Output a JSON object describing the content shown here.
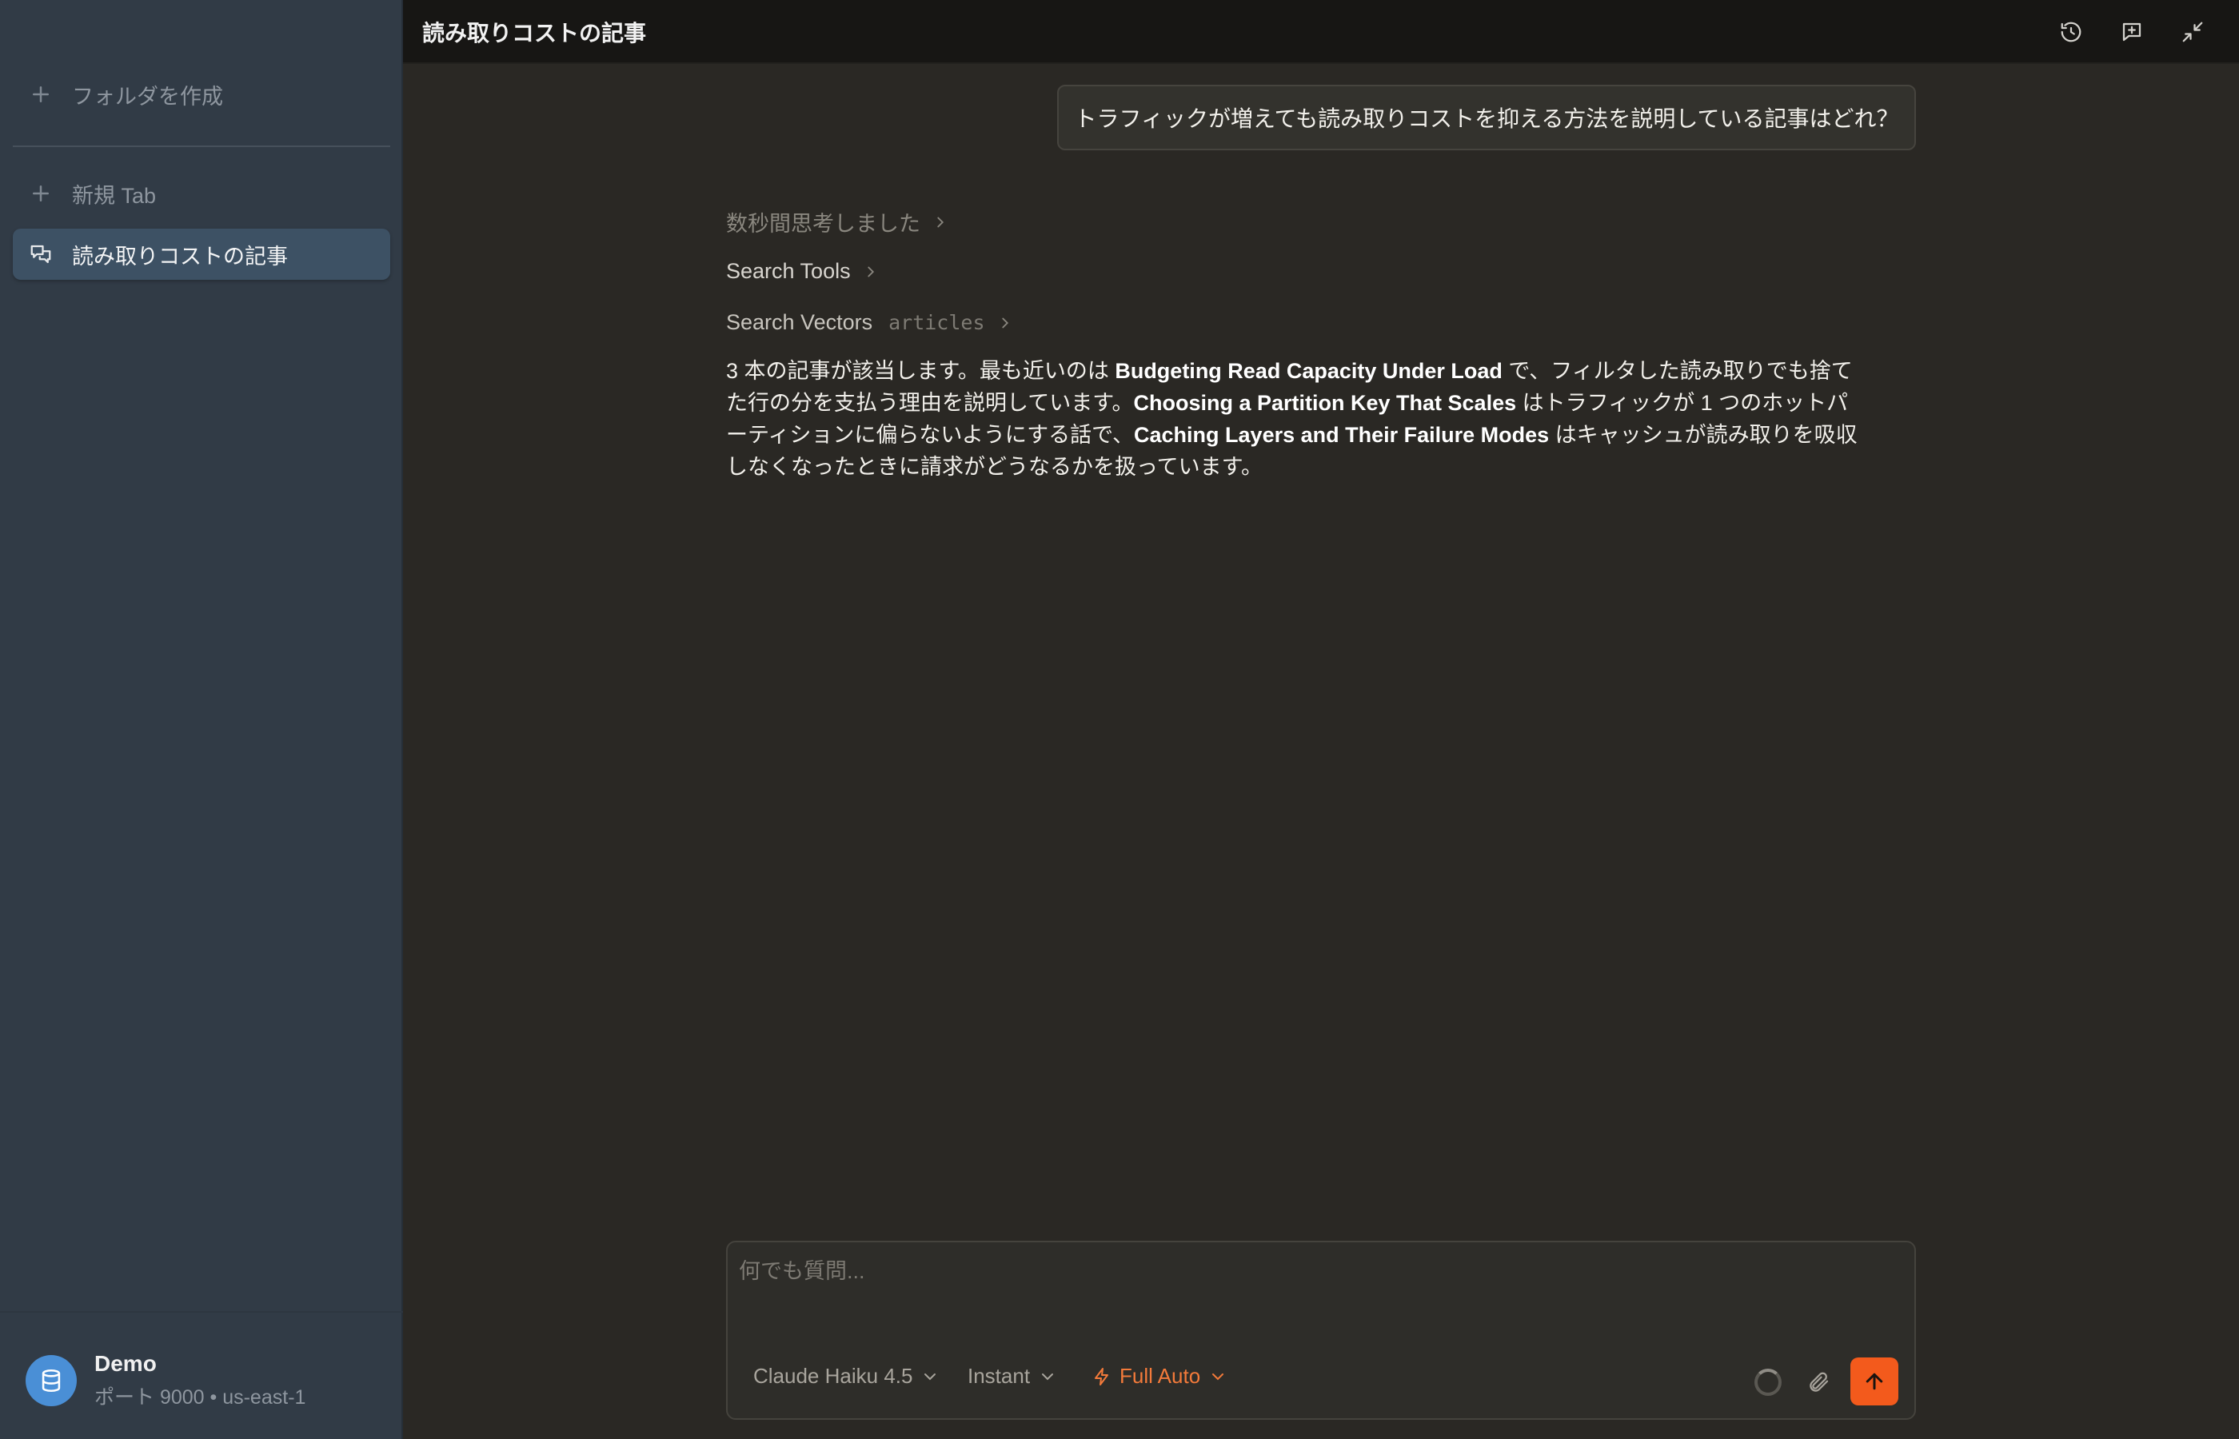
{
  "sidebar": {
    "create_folder": "フォルダを作成",
    "new_tab": "新規 Tab",
    "active_chat": "読み取りコストの記事",
    "profile": {
      "name": "Demo",
      "details": "ポート 9000 • us-east-1"
    }
  },
  "header": {
    "title": "読み取りコストの記事",
    "icons": [
      "history-icon",
      "new-chat-icon",
      "collapse-icon"
    ]
  },
  "chat": {
    "user_message": "トラフィックが増えても読み取りコストを抑える方法を説明している記事はどれ？",
    "steps": {
      "thinking": "数秒間思考しました",
      "search_tools": "Search Tools",
      "search_vectors": "Search Vectors",
      "search_vectors_arg": "articles"
    },
    "answer": {
      "p1": "3 本の記事が該当します。最も近いのは ",
      "b1": "Budgeting Read Capacity Under Load",
      "p2": " で、フィルタした読み取りでも捨てた行の分を支払う理由を説明しています。",
      "b2": "Choosing a Partition Key That Scales",
      "p3": " はトラフィックが 1 つのホットパーティションに偏らないようにする話で、",
      "b3": "Caching Layers and Their Failure Modes",
      "p4": " はキャッシュが読み取りを吸収しなくなったときに請求がどうなるかを扱っています。"
    }
  },
  "composer": {
    "placeholder": "何でも質問...",
    "model": "Claude Haiku 4.5",
    "mode": "Instant",
    "autonomy": "Full Auto"
  },
  "colors": {
    "accent": "#f35a1c",
    "sidebar_bg": "#313b46",
    "main_bg": "#2a2824"
  }
}
